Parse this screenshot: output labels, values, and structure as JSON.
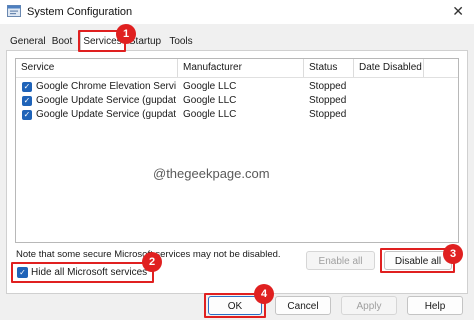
{
  "window": {
    "title": "System Configuration",
    "close_glyph": "✕"
  },
  "tabs": [
    {
      "label": "General"
    },
    {
      "label": "Boot"
    },
    {
      "label": "Services",
      "selected": true
    },
    {
      "label": "Startup"
    },
    {
      "label": "Tools"
    }
  ],
  "services": {
    "columns": [
      "Service",
      "Manufacturer",
      "Status",
      "Date Disabled"
    ],
    "rows": [
      {
        "checked": true,
        "service": "Google Chrome Elevation Servic...",
        "manufacturer": "Google LLC",
        "status": "Stopped",
        "date_disabled": ""
      },
      {
        "checked": true,
        "service": "Google Update Service (gupdate)",
        "manufacturer": "Google LLC",
        "status": "Stopped",
        "date_disabled": ""
      },
      {
        "checked": true,
        "service": "Google Update Service (gupdatem)",
        "manufacturer": "Google LLC",
        "status": "Stopped",
        "date_disabled": ""
      }
    ],
    "watermark": "@thegeekpage.com"
  },
  "note": "Note that some secure Microsoft services may not be disabled.",
  "hide_ms_services": {
    "label": "Hide all Microsoft services",
    "checked": true
  },
  "buttons": {
    "enable_all": "Enable all",
    "disable_all": "Disable all",
    "ok": "OK",
    "cancel": "Cancel",
    "apply": "Apply",
    "help": "Help"
  },
  "annotations": [
    "1",
    "2",
    "3",
    "4"
  ],
  "colors": {
    "highlight": "#e02020",
    "accent": "#1f63b8"
  }
}
